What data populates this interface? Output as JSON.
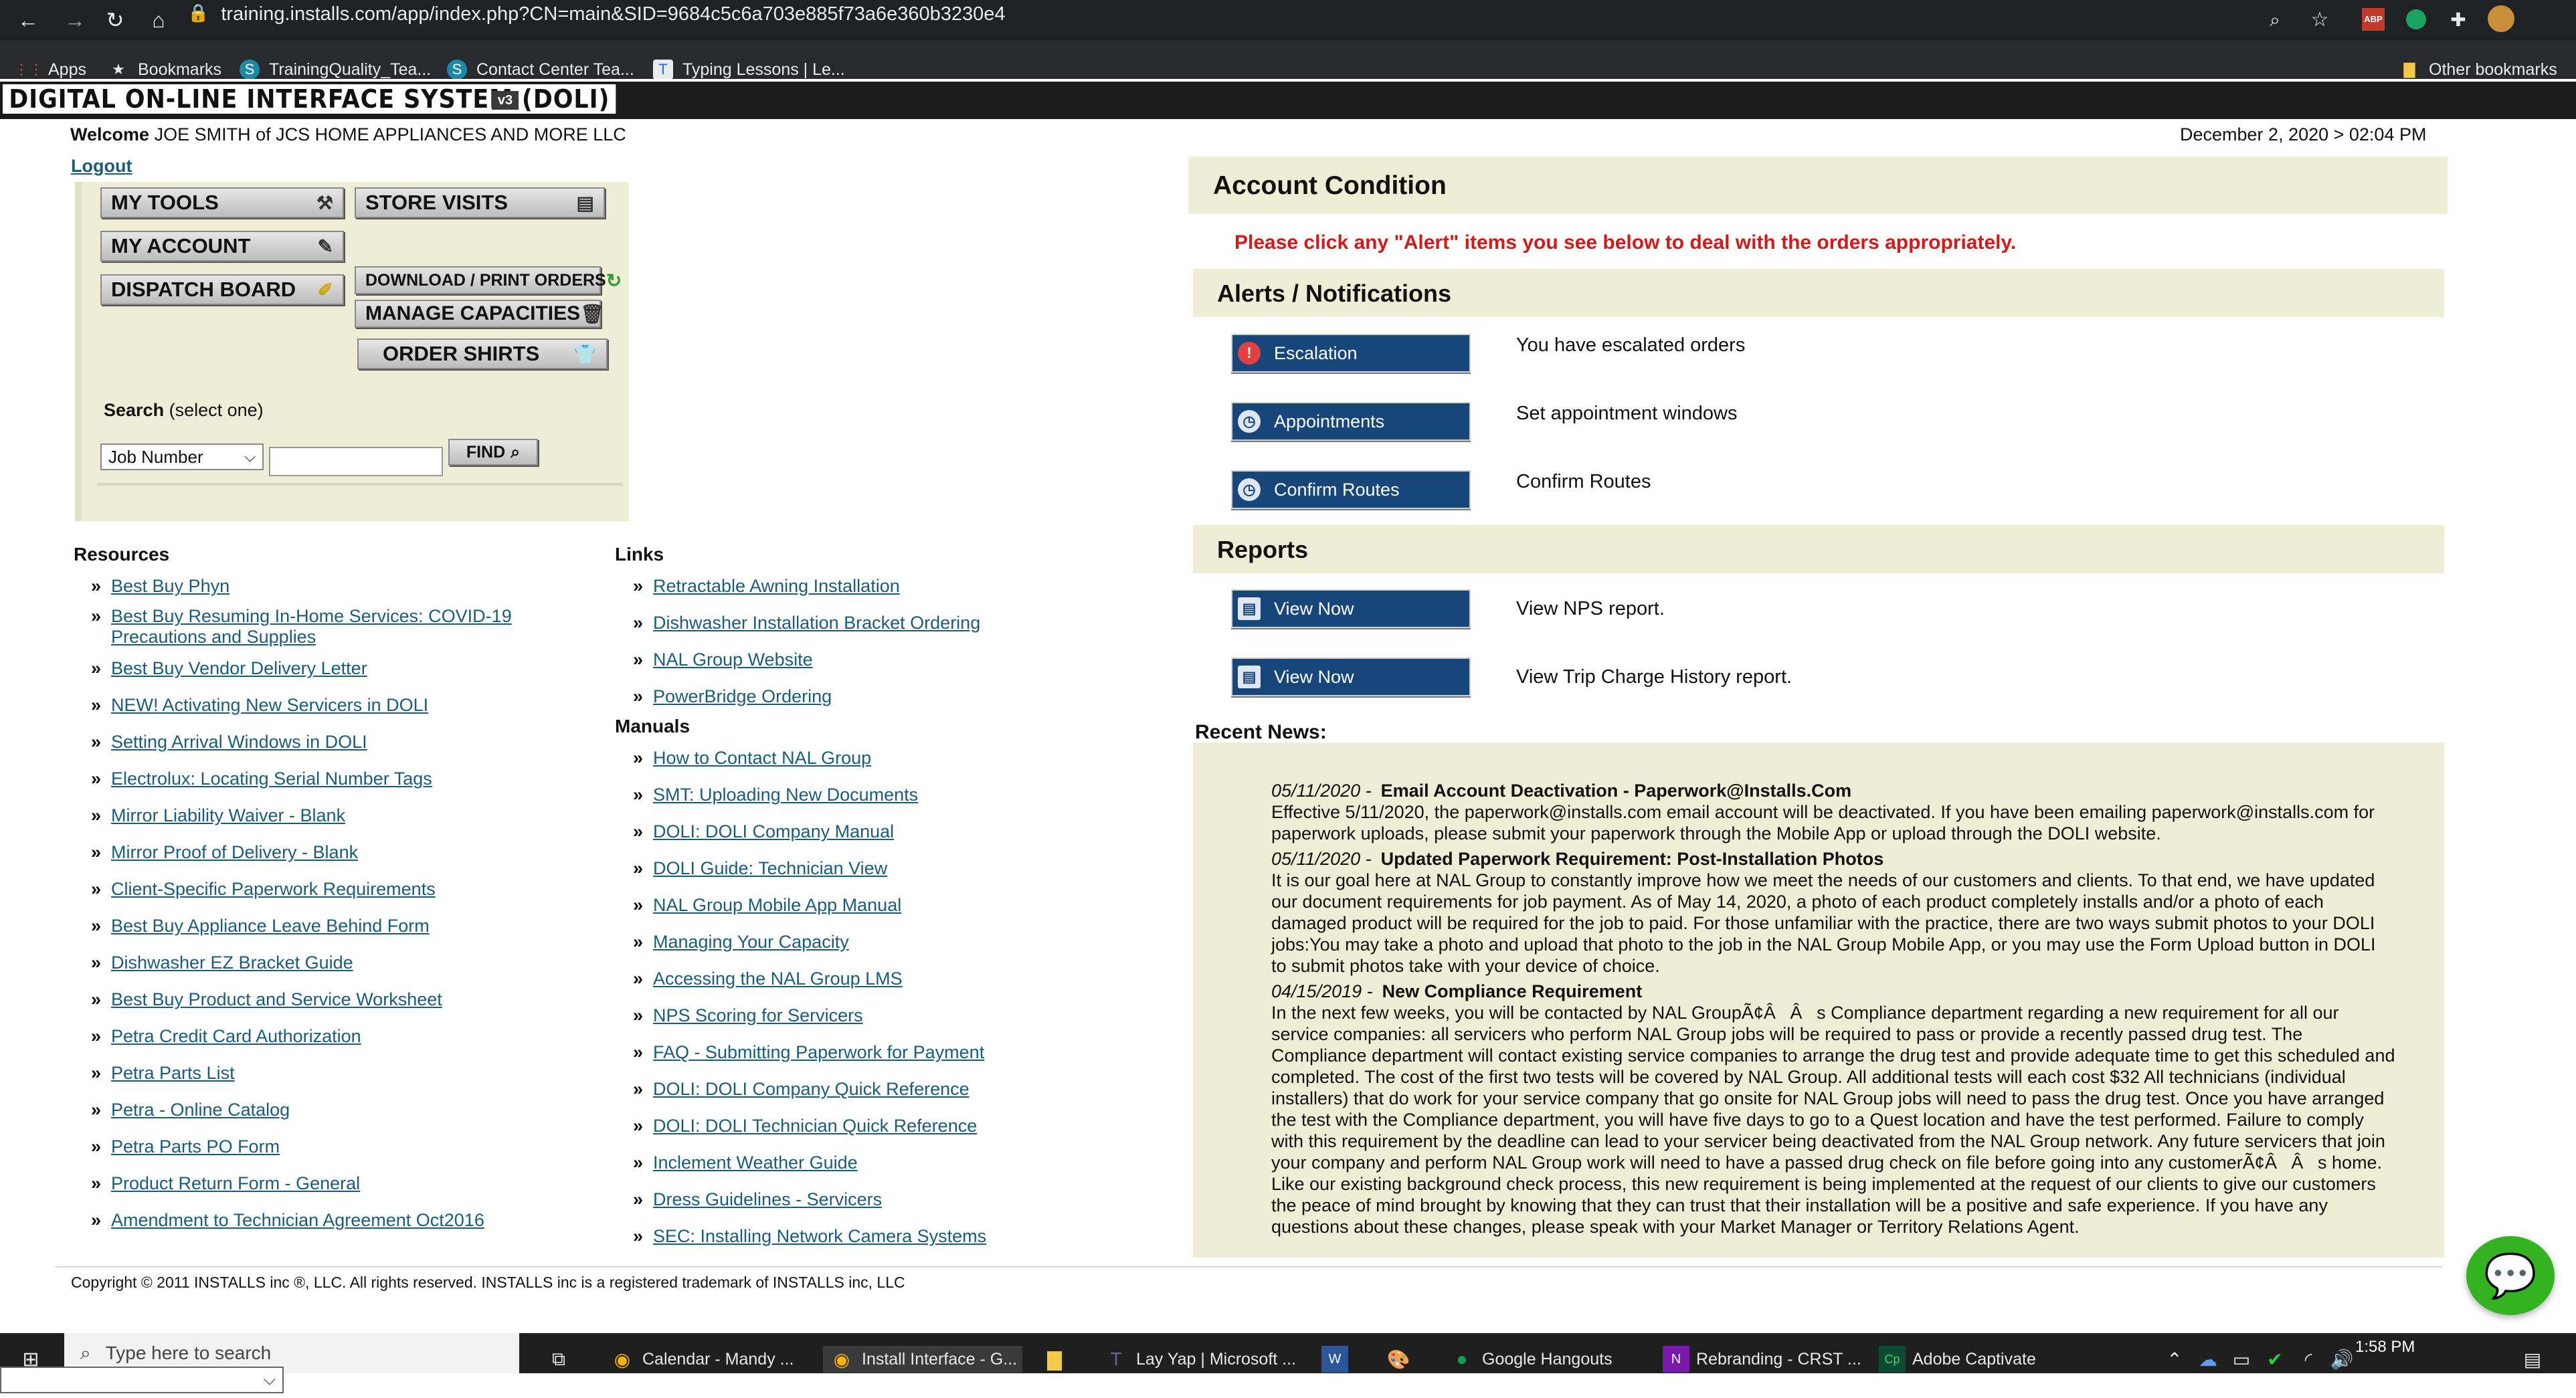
{
  "browser": {
    "url": "training.installs.com/app/index.php?CN=main&SID=9684c5c6a703e885f73a6e360b3230e4",
    "bookmarks": [
      "Apps",
      "Bookmarks",
      "TrainingQuality_Tea...",
      "Contact Center Tea...",
      "Typing Lessons | Le..."
    ],
    "other_bookmarks": "Other bookmarks",
    "abp": "ABP"
  },
  "header": {
    "title": "DIGITAL ON-LINE INTERFACE SYSTEM (DOLI)",
    "version": "v3",
    "welcome_label": "Welcome",
    "user_name": "JOE SMITH",
    "of_company": "of JCS HOME APPLIANCES AND MORE LLC",
    "datetime": "December 2, 2020 > 02:04 PM",
    "logout": "Logout"
  },
  "tools": {
    "my_tools": "MY TOOLS",
    "store_visits": "STORE VISITS",
    "my_account": "MY ACCOUNT",
    "dispatch_board": "DISPATCH BOARD",
    "download_print": "DOWNLOAD / PRINT ORDERS",
    "manage_capacities": "MANAGE CAPACITIES",
    "order_shirts": "ORDER SHIRTS",
    "search_label": "Search",
    "search_hint": "(select one)",
    "search_select": "Job Number",
    "find": "FIND"
  },
  "resources": {
    "heading": "Resources",
    "items": [
      "Best Buy Phyn",
      "Best Buy Resuming In-Home Services: COVID-19",
      "Precautions and Supplies",
      "Best Buy Vendor Delivery Letter",
      "NEW! Activating New Servicers in DOLI",
      "Setting Arrival Windows in DOLI",
      "Electrolux: Locating Serial Number Tags",
      "Mirror Liability Waiver - Blank",
      "Mirror Proof of Delivery - Blank",
      "Client-Specific Paperwork Requirements",
      "Best Buy Appliance Leave Behind Form",
      "Dishwasher EZ Bracket Guide",
      "Best Buy Product and Service Worksheet",
      "Petra Credit Card Authorization",
      "Petra Parts List",
      "Petra - Online Catalog",
      "Petra Parts PO Form",
      "Product Return Form - General",
      "Amendment to Technician Agreement Oct2016"
    ]
  },
  "links": {
    "heading": "Links",
    "items": [
      "Retractable Awning Installation",
      "Dishwasher Installation Bracket Ordering",
      "NAL Group Website",
      "PowerBridge Ordering"
    ]
  },
  "manuals": {
    "heading": "Manuals",
    "items": [
      "How to Contact NAL Group",
      "SMT: Uploading New Documents",
      "DOLI: DOLI Company Manual",
      "DOLI Guide: Technician View",
      "NAL Group Mobile App Manual",
      "Managing Your Capacity",
      "Accessing the NAL Group LMS",
      "NPS Scoring for Servicers",
      "FAQ - Submitting Paperwork for Payment",
      "DOLI: DOLI Company Quick Reference",
      "DOLI: DOLI Technician Quick Reference",
      "Inclement Weather Guide",
      "Dress Guidelines - Servicers",
      "SEC: Installing Network Camera Systems"
    ]
  },
  "account": {
    "title": "Account Condition",
    "alert_message": "Please click any \"Alert\" items you see below to deal with the orders appropriately.",
    "alerts_title": "Alerts / Notifications",
    "alerts": [
      {
        "button": "Escalation",
        "desc": "You have escalated orders"
      },
      {
        "button": "Appointments",
        "desc": "Set appointment windows"
      },
      {
        "button": "Confirm Routes",
        "desc": "Confirm Routes"
      }
    ],
    "reports_title": "Reports",
    "reports": [
      {
        "button": "View Now",
        "desc": "View NPS report."
      },
      {
        "button": "View Now",
        "desc": "View Trip Charge History report."
      }
    ]
  },
  "news": {
    "heading": "Recent News:",
    "items": [
      {
        "date": "05/11/2020 -",
        "title": "Email Account Deactivation - Paperwork@Installs.Com",
        "body": "Effective 5/11/2020, the paperwork@installs.com email account will be deactivated. If you have been emailing paperwork@installs.com for paperwork uploads, please submit your paperwork through the Mobile App or upload through the DOLI website."
      },
      {
        "date": "05/11/2020 -",
        "title": "Updated Paperwork Requirement: Post-Installation Photos",
        "body": "It is our goal here at NAL Group to constantly improve how we meet the needs of our customers and clients. To that end, we have updated our document requirements for job payment. As of May 14, 2020, a photo of each product completely installs and/or a photo of each damaged product will be required for the job to paid. For those unfamiliar with the practice, there are two ways submit photos to your DOLI jobs:You may take a photo and upload that photo to the job in the NAL Group Mobile App, or you may use the Form Upload button in DOLI to submit photos take with your device of choice."
      },
      {
        "date": "04/15/2019 -",
        "title": "New Compliance Requirement",
        "body": "In the next few weeks, you will be contacted by NAL GroupÃ¢ÂÂs Compliance department regarding a new requirement for all our service companies: all servicers who perform NAL Group jobs will be required to pass or provide a recently passed drug test. The Compliance department will contact existing service companies to arrange the drug test and provide adequate time to get this scheduled and completed. The cost of the first two tests will be covered by NAL Group. All additional tests will each cost $32 All technicians (individual installers) that do work for your service company that go onsite for NAL Group jobs will need to pass the drug test. Once you have arranged the test with the Compliance department, you will have five days to go to a Quest location and have the test performed. Failure to comply with this requirement by the deadline can lead to your servicer being deactivated from the NAL Group network. Any future servicers that join your company and perform NAL Group work will need to have a passed drug check on file before going into any customerÃ¢ÂÂs home. Like our existing background check process, this new requirement is being implemented at the request of our clients to give our customers the peace of mind brought by knowing that they can trust that their installation will be a positive and safe experience. If you have any questions about these changes, please speak with your Market Manager or Territory Relations Agent."
      }
    ]
  },
  "footer": {
    "copyright": "Copyright © 2011 INSTALLS inc ®, LLC. All rights reserved. INSTALLS inc is a registered trademark of INSTALLS inc, LLC"
  },
  "taskbar": {
    "search_placeholder": "Type here to search",
    "apps": [
      "Calendar - Mandy ...",
      "Install Interface - G...",
      "Lay Yap | Microsoft ...",
      "Google Hangouts",
      "Rebranding - CRST ...",
      "Adobe Captivate"
    ],
    "clock": "1:58 PM"
  },
  "icons": {
    "accent_blue": "#17467a",
    "panel_beige": "#eeeed6",
    "alert_red": "#d31a1a",
    "link_color": "#1a5c7a"
  }
}
